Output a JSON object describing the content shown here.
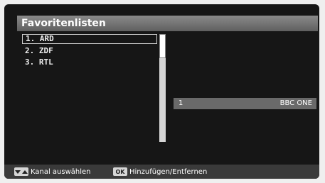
{
  "title": "Favoritenlisten",
  "channel_list": {
    "items": [
      {
        "label": "1. ARD",
        "selected": true
      },
      {
        "label": "2. ZDF",
        "selected": false
      },
      {
        "label": "3. RTL",
        "selected": false
      }
    ]
  },
  "channel_info": {
    "number": "1",
    "name": "BBC ONE"
  },
  "footer": {
    "nav_icon": "up-down-arrows-icon",
    "nav_label": "Kanal auswählen",
    "ok_key": "OK",
    "ok_label": "Hinzufügen/Entfernen"
  }
}
